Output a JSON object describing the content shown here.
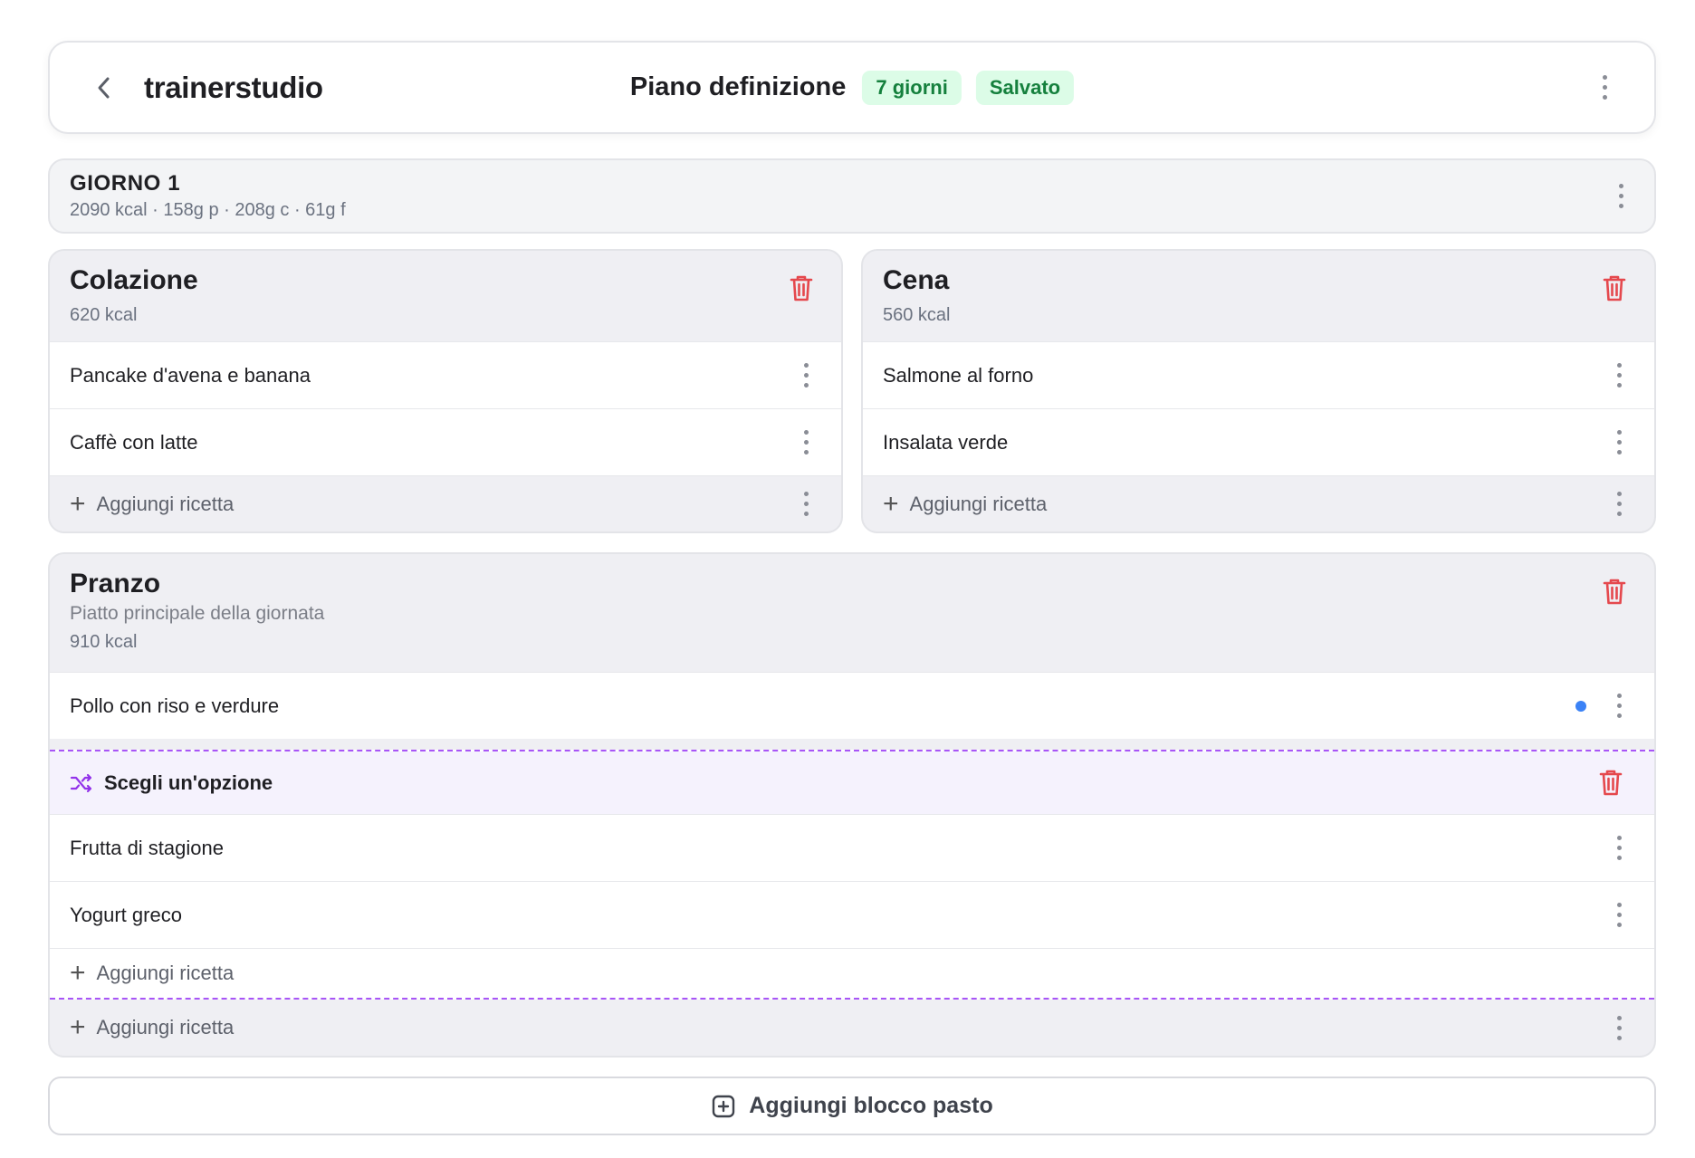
{
  "app": {
    "brand": "trainerstudio"
  },
  "plan": {
    "name": "Piano definizione",
    "duration_badge": "7 giorni",
    "status_badge": "Salvato"
  },
  "day": {
    "title": "GIORNO 1",
    "macros": "2090 kcal · 158g p · 208g c · 61g f"
  },
  "meals": {
    "colazione": {
      "title": "Colazione",
      "kcal": "620 kcal",
      "items": [
        "Pancake d'avena e banana",
        "Caffè con latte"
      ],
      "add_label": "Aggiungi ricetta"
    },
    "cena": {
      "title": "Cena",
      "kcal": "560 kcal",
      "items": [
        "Salmone al forno",
        "Insalata verde"
      ],
      "add_label": "Aggiungi ricetta"
    },
    "pranzo": {
      "title": "Pranzo",
      "subtitle": "Piatto principale della giornata",
      "kcal": "910 kcal",
      "items": [
        "Pollo con riso e verdure"
      ],
      "option_group": {
        "label": "Scegli un'opzione",
        "items": [
          "Frutta di stagione",
          "Yogurt greco"
        ],
        "add_label": "Aggiungi ricetta"
      },
      "add_label": "Aggiungi ricetta"
    }
  },
  "add_block_label": "Aggiungi blocco pasto",
  "colors": {
    "accent_green_bg": "#dcfce7",
    "accent_green_text": "#15803d",
    "delete_red": "#e5484d",
    "option_purple": "#a855f7",
    "indicator_blue": "#3b82f6"
  },
  "icons": [
    "chevron-left-icon",
    "more-vertical-icon",
    "trash-icon",
    "shuffle-icon",
    "plus-icon",
    "plus-square-icon"
  ]
}
